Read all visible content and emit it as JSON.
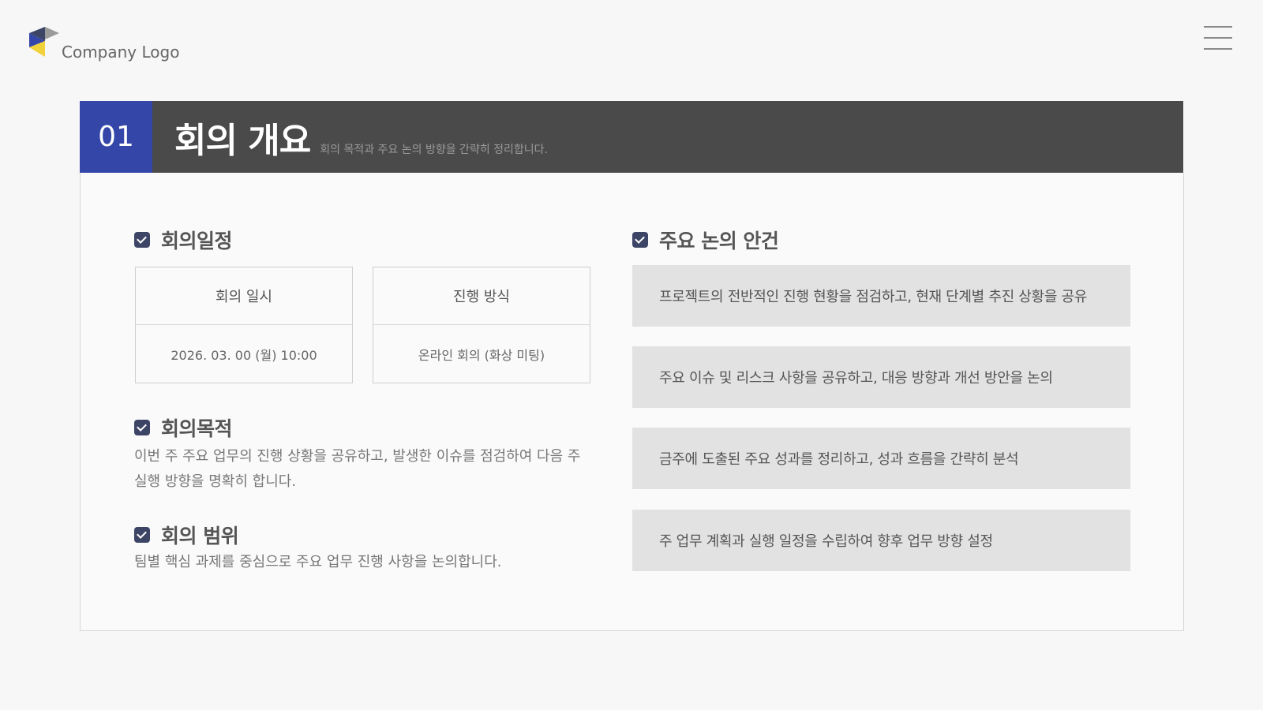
{
  "logo": {
    "text": "Company Logo"
  },
  "header": {
    "number": "01",
    "title": "회의 개요",
    "subtitle": "회의 목적과 주요 논의 방향을 간략히 정리합니다."
  },
  "schedule": {
    "title": "회의일정",
    "boxes": [
      {
        "label": "회의 일시",
        "value": "2026. 03. 00 (월) 10:00"
      },
      {
        "label": "진행 방식",
        "value": "온라인 회의 (화상 미팅)"
      }
    ]
  },
  "purpose": {
    "title": "회의목적",
    "lines": [
      "이번 주 주요 업무의 진행 상황을 공유하고, 발생한 이슈를 점검하여 다음 주",
      "실행 방향을 명확히 합니다."
    ]
  },
  "scope": {
    "title": "회의 범위",
    "text": "팀별 핵심 과제를 중심으로 주요 업무 진행 사항을 논의합니다."
  },
  "agenda": {
    "title": "주요 논의 안건",
    "items": [
      "프로젝트의 전반적인 진행 현황을 점검하고, 현재 단계별 추진 상황을 공유",
      "주요 이슈 및 리스크 사항을 공유하고, 대응 방향과 개선 방안을 논의",
      "금주에 도출된 주요 성과를 정리하고, 성과 흐름을 간략히 분석",
      "주 업무 계획과 실행 일정을 수립하여 향후 업무 방향 설정"
    ]
  },
  "colors": {
    "accent": "#3446a8",
    "header_bg": "#4a4a4a",
    "check_icon": "#3d4567",
    "agenda_bg": "#e2e2e2"
  }
}
